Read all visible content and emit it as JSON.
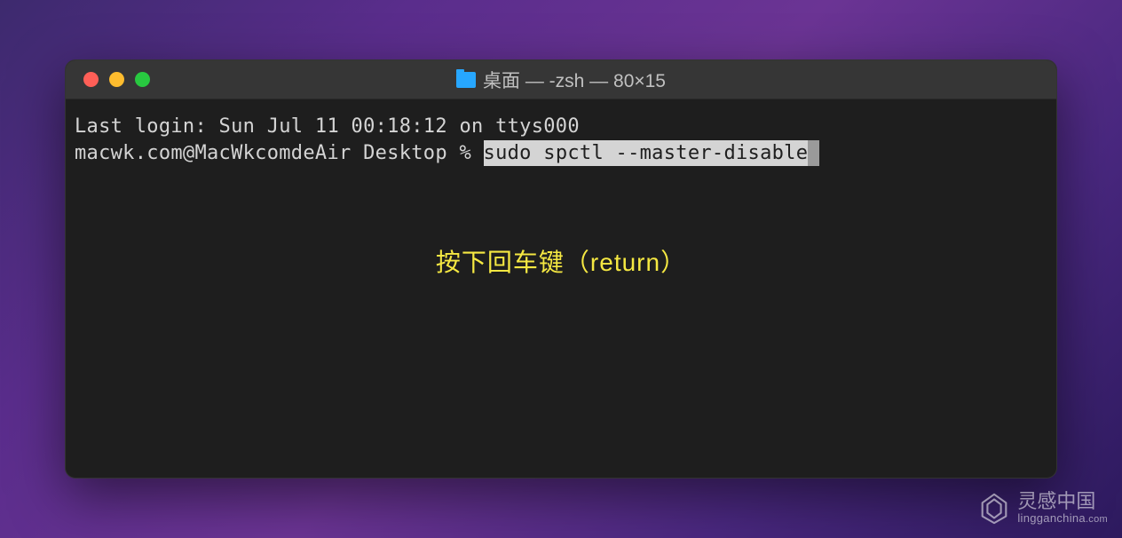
{
  "titlebar": {
    "icon": "folder-icon",
    "title": "桌面 — -zsh — 80×15"
  },
  "terminal": {
    "last_login": "Last login: Sun Jul 11 00:18:12 on ttys000",
    "prompt": "macwk.com@MacWkcomdeAir Desktop % ",
    "command": "sudo spctl --master-disable"
  },
  "annotation": {
    "text": "按下回车键（return）"
  },
  "watermark": {
    "cn": "灵感中国",
    "en": "lingganchina",
    "suffix": ".com"
  }
}
